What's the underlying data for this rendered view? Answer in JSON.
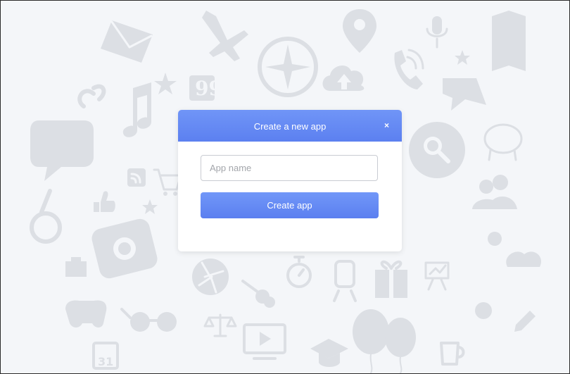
{
  "modal": {
    "title": "Create a new app",
    "close_label": "×",
    "app_name_input": {
      "value": "",
      "placeholder": "App name"
    },
    "create_button_label": "Create app"
  },
  "colors": {
    "accent": "#6387f3",
    "background": "#f4f6f9",
    "background_icons": "#dcdfe4"
  },
  "background_icons": [
    "mail-icon",
    "airplane-icon",
    "map-pin-icon",
    "microphone-icon",
    "book-icon",
    "star-icon",
    "music-note-icon",
    "quote-icon",
    "compass-icon",
    "cloud-upload-icon",
    "phone-icon",
    "chat-icon",
    "search-icon",
    "piggy-bank-icon",
    "rss-icon",
    "cart-icon",
    "thumbs-up-icon",
    "camera-icon",
    "users-icon",
    "shutter-icon",
    "guitar-icon",
    "stopwatch-icon",
    "train-icon",
    "gift-icon",
    "presentation-icon",
    "gamepad-icon",
    "glasses-icon",
    "scales-icon",
    "video-player-icon",
    "graduation-cap-icon",
    "balloons-icon",
    "calendar-icon",
    "pencil-icon"
  ]
}
